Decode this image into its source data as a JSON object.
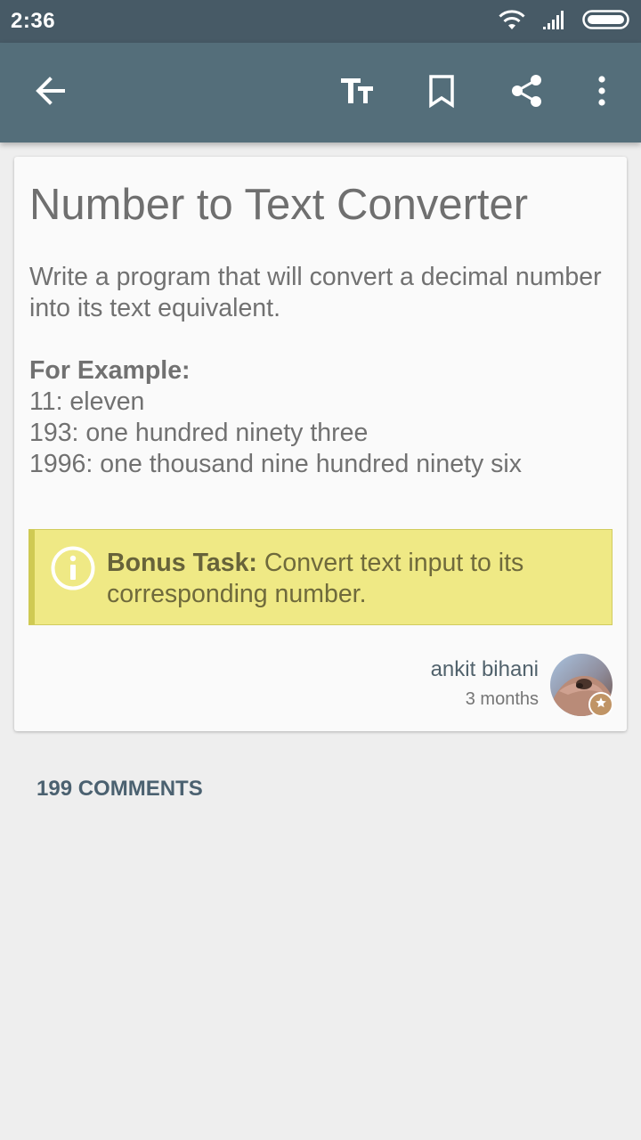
{
  "status_bar": {
    "time": "2:36",
    "icons": [
      "wifi-icon",
      "signal-icon",
      "battery-icon"
    ]
  },
  "toolbar": {
    "actions": [
      "back-arrow-icon",
      "text-size-icon",
      "bookmark-icon",
      "share-icon",
      "more-vert-icon"
    ]
  },
  "post": {
    "title": "Number to Text Converter",
    "description": "Write a program that will convert a decimal number into its text equivalent.",
    "example_heading": "For Example:",
    "examples": [
      "11: eleven",
      "193: one hundred ninety three",
      "1996: one thousand nine hundred ninety six"
    ],
    "bonus": {
      "icon": "info-icon",
      "label": "Bonus Task:",
      "text": " Convert text input to its corresponding number."
    },
    "author": {
      "name": "ankit bihani",
      "time": "3 months",
      "badge_icon": "star-icon"
    }
  },
  "comments": {
    "header": "199 COMMENTS"
  },
  "colors": {
    "status_bar": "#475a66",
    "toolbar": "#546e7a",
    "background": "#eeeeee",
    "card": "#fafafa",
    "bonus_background": "#efe985",
    "bonus_border": "#cfca53",
    "comments_header": "#4b6170",
    "avatar_badge": "#c09465"
  }
}
